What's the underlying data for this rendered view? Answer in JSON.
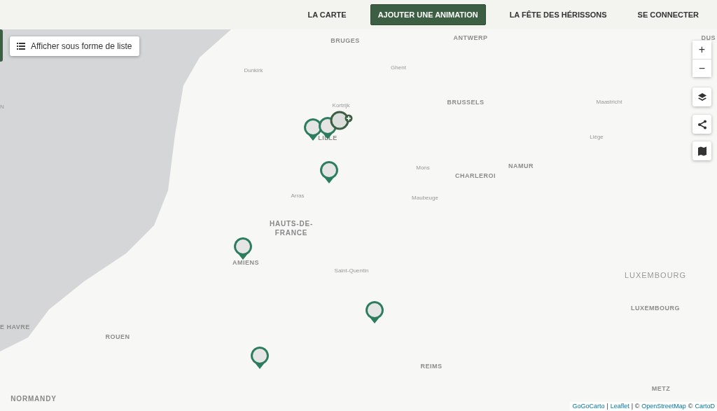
{
  "nav": [
    {
      "label": "LA CARTE",
      "kind": "link"
    },
    {
      "label": "AJOUTER UNE ANIMATION",
      "kind": "button"
    },
    {
      "label": "LA FÊTE DES HÉRISSONS",
      "kind": "link"
    },
    {
      "label": "SE CONNECTER",
      "kind": "link"
    }
  ],
  "list_button": {
    "label": "Afficher sous forme de liste"
  },
  "map": {
    "labels": [
      {
        "text": "BRUGES",
        "kind": "city"
      },
      {
        "text": "ANTWERP",
        "kind": "city"
      },
      {
        "text": "DUS",
        "kind": "city"
      },
      {
        "text": "Dunkirk",
        "kind": "town"
      },
      {
        "text": "Ghent",
        "kind": "town"
      },
      {
        "text": "N",
        "kind": "town"
      },
      {
        "text": "Kortrijk",
        "kind": "town"
      },
      {
        "text": "BRUSSELS",
        "kind": "city"
      },
      {
        "text": "Maastricht",
        "kind": "town"
      },
      {
        "text": "LILLE",
        "kind": "city"
      },
      {
        "text": "Liège",
        "kind": "town"
      },
      {
        "text": "Mons",
        "kind": "town"
      },
      {
        "text": "NAMUR",
        "kind": "city"
      },
      {
        "text": "CHARLEROI",
        "kind": "city"
      },
      {
        "text": "Arras",
        "kind": "town"
      },
      {
        "text": "Maubeuge",
        "kind": "town"
      },
      {
        "text": "HAUTS-DE-",
        "kind": "region"
      },
      {
        "text": "FRANCE",
        "kind": "region"
      },
      {
        "text": "AMIENS",
        "kind": "city"
      },
      {
        "text": "Saint-Quentin",
        "kind": "town"
      },
      {
        "text": "LUXEMBOURG",
        "kind": "country"
      },
      {
        "text": "LUXEMBOURG",
        "kind": "city"
      },
      {
        "text": "E HAVRE",
        "kind": "city"
      },
      {
        "text": "ROUEN",
        "kind": "city"
      },
      {
        "text": "REIMS",
        "kind": "city"
      },
      {
        "text": "NORMANDY",
        "kind": "region"
      },
      {
        "text": "METZ",
        "kind": "city"
      }
    ],
    "markers": [
      {
        "kind": "pin"
      },
      {
        "kind": "pin"
      },
      {
        "kind": "cluster"
      },
      {
        "kind": "pin"
      },
      {
        "kind": "pin"
      },
      {
        "kind": "pin"
      },
      {
        "kind": "pin"
      }
    ],
    "controls": [
      {
        "label": "+"
      },
      {
        "label": "−"
      }
    ],
    "attribution": [
      {
        "text": "GoGoCarto",
        "kind": "link"
      },
      {
        "text": "|",
        "kind": "sep"
      },
      {
        "text": "Leaflet",
        "kind": "link"
      },
      {
        "text": "| ©",
        "kind": "sep"
      },
      {
        "text": "OpenStreetMap",
        "kind": "link"
      },
      {
        "text": "©",
        "kind": "sep"
      },
      {
        "text": "CartoD",
        "kind": "link"
      }
    ]
  }
}
